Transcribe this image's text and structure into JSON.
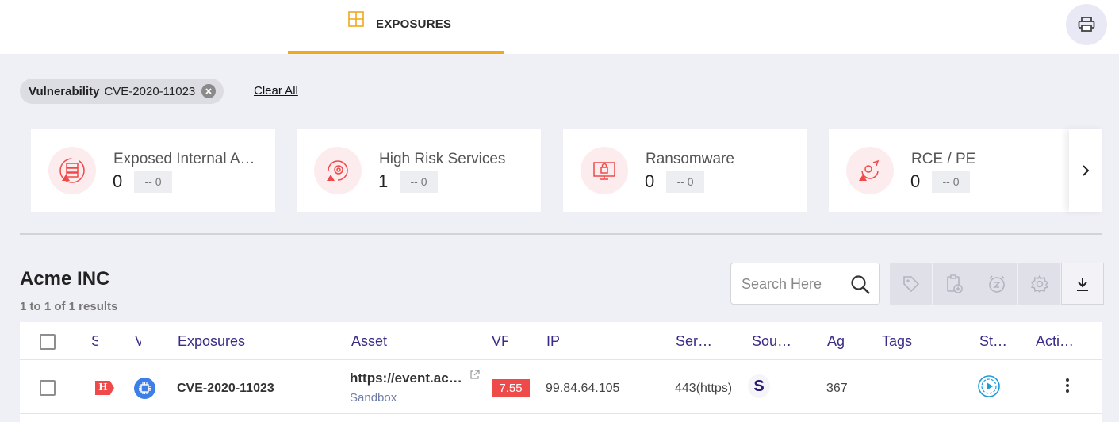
{
  "header": {
    "tab_label": "EXPOSURES",
    "tab_icon": "grid-icon",
    "print_icon": "printer-icon"
  },
  "filters": {
    "chip_key": "Vulnerability",
    "chip_value": "CVE-2020-11023",
    "clear_all": "Clear All"
  },
  "cards": [
    {
      "title": "Exposed Internal A…",
      "count": "0",
      "delta": "-- 0",
      "icon": "server-alert-icon"
    },
    {
      "title": "High Risk Services",
      "count": "1",
      "delta": "-- 0",
      "icon": "gear-cycle-alert-icon"
    },
    {
      "title": "Ransomware",
      "count": "0",
      "delta": "-- 0",
      "icon": "ransomware-monitor-icon"
    },
    {
      "title": "RCE / PE",
      "count": "0",
      "delta": "-- 0",
      "icon": "bug-alert-icon"
    }
  ],
  "section": {
    "title": "Acme INC",
    "results": "1 to 1 of 1 results"
  },
  "search": {
    "placeholder": "Search Here"
  },
  "toolbar": [
    "tag-icon",
    "clipboard-add-icon",
    "snooze-icon",
    "settings-icon",
    "download-icon"
  ],
  "table": {
    "columns": [
      "S",
      "V",
      "Exposures",
      "Asset",
      "VF",
      "IP",
      "Ser…",
      "Sou…",
      "Ag",
      "Tags",
      "St…",
      "Acti…"
    ],
    "rows": [
      {
        "severity": "H",
        "exposure": "CVE-2020-11023",
        "asset": "https://event.ac…",
        "asset_sub": "Sandbox",
        "vpr": "7.55",
        "ip": "99.84.64.105",
        "service": "443(https)",
        "source": "S",
        "age": "367",
        "tags": ""
      }
    ]
  },
  "colors": {
    "accent": "#f0a81c",
    "critical": "#ef4949",
    "header_text": "#3b2a86",
    "link": "#3d7fe6"
  }
}
